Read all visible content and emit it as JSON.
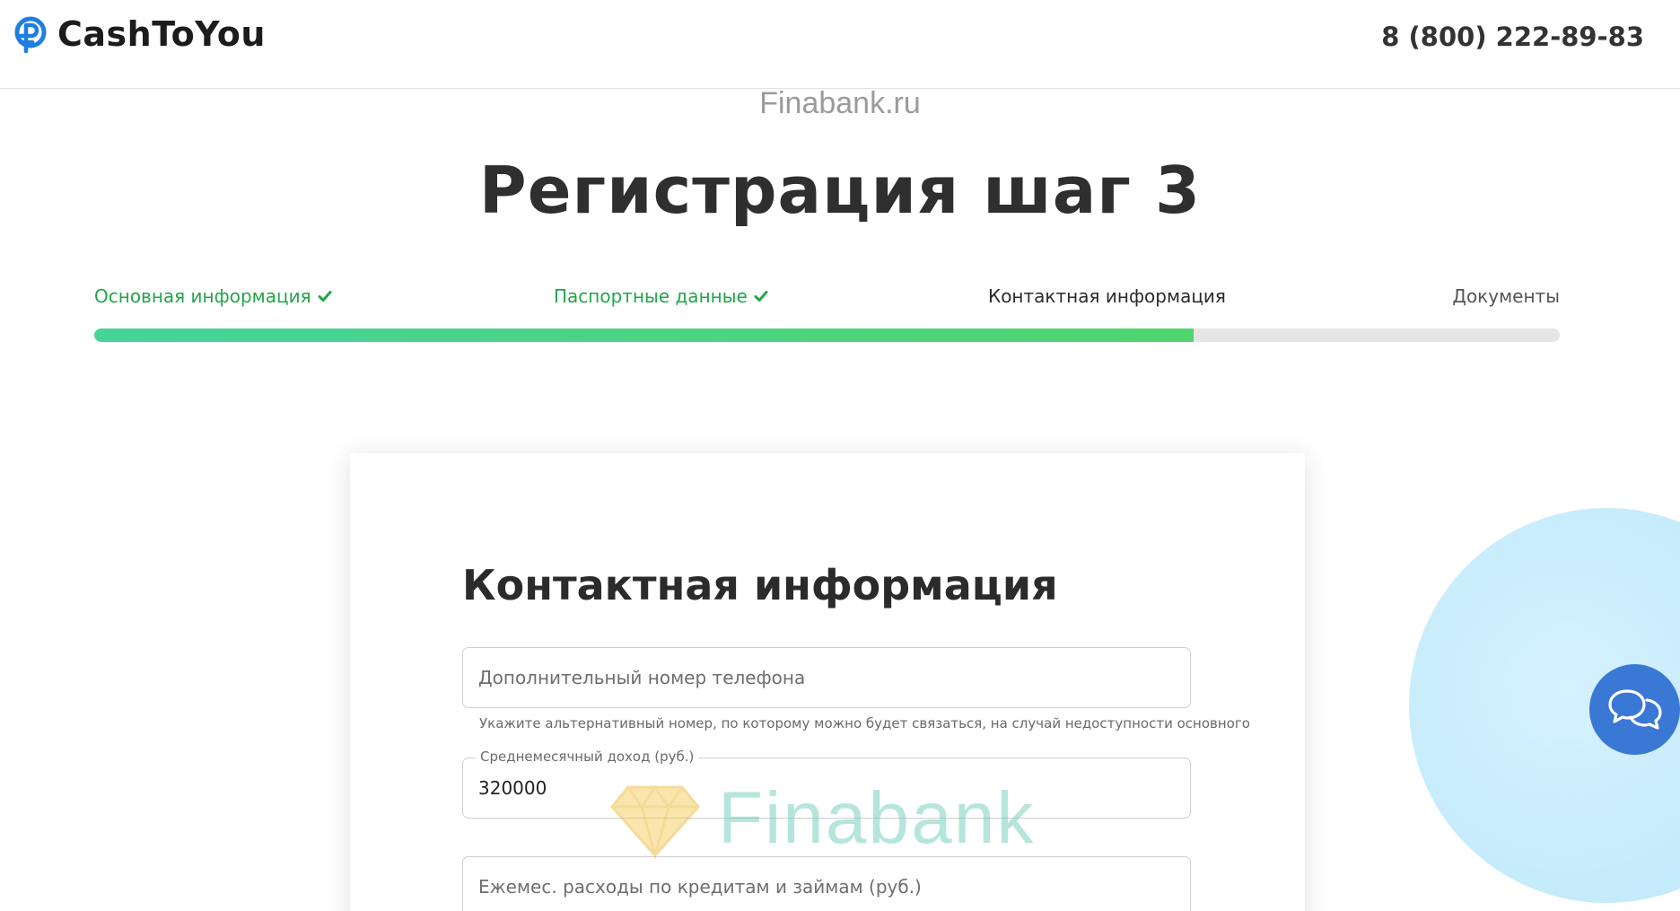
{
  "header": {
    "brand": "CashToYou",
    "phone": "8 (800) 222-89-83"
  },
  "watermark": {
    "top_text": "Finabank.ru",
    "bottom_text": "Finabank"
  },
  "page_title": "Регистрация шаг 3",
  "steps": [
    {
      "label": "Основная информация",
      "status": "done"
    },
    {
      "label": "Паспортные данные",
      "status": "done"
    },
    {
      "label": "Контактная информация",
      "status": "current"
    },
    {
      "label": "Документы",
      "status": "pending"
    }
  ],
  "progress": {
    "percent": 75
  },
  "form": {
    "title": "Контактная информация",
    "extra_phone": {
      "placeholder": "Дополнительный номер телефона",
      "value": "",
      "hint": "Укажите альтернативный номер, по которому можно будет связаться, на случай недоступности основного"
    },
    "income": {
      "label": "Среднемесячный доход (руб.)",
      "value": "320000"
    },
    "expenses": {
      "placeholder": "Ежемес. расходы по кредитам и займам (руб.)",
      "value": ""
    }
  },
  "colors": {
    "accent_green": "#22a64a",
    "chat_blue": "#3a78d6",
    "logo_blue": "#1e7fe0"
  },
  "icons": {
    "logo": "ruble-coin-icon",
    "step_done": "checkmark-icon",
    "chat": "chat-bubbles-icon",
    "watermark": "diamond-icon"
  }
}
